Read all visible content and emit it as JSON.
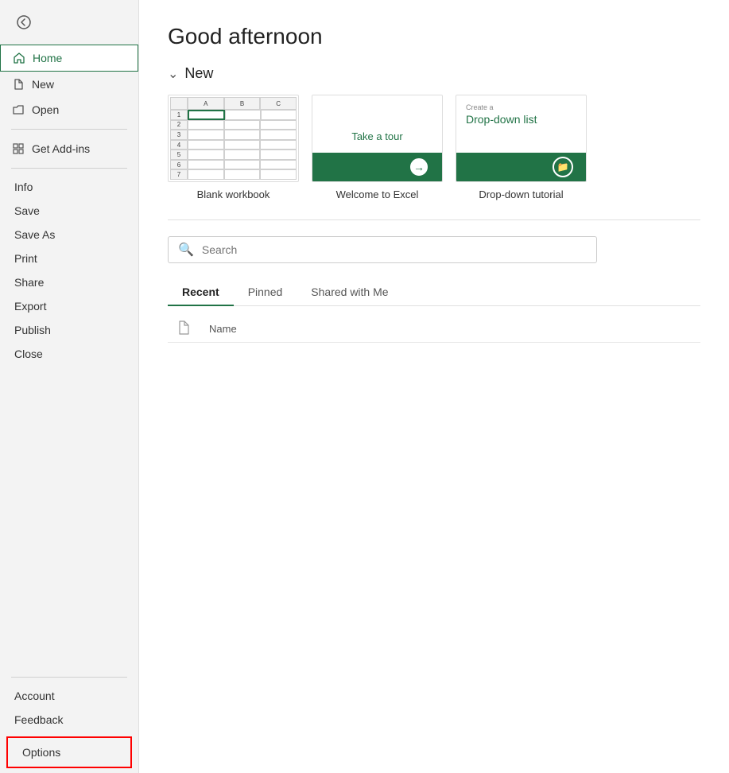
{
  "greeting": "Good afternoon",
  "sidebar": {
    "back_label": "Back",
    "items": [
      {
        "id": "home",
        "label": "Home",
        "icon": "🏠",
        "active": true
      },
      {
        "id": "new",
        "label": "New",
        "icon": "📄"
      },
      {
        "id": "open",
        "label": "Open",
        "icon": "📂"
      }
    ],
    "get_addins": "Get Add-ins",
    "simple_items": [
      "Info",
      "Save",
      "Save As",
      "Print",
      "Share",
      "Export",
      "Publish",
      "Close"
    ],
    "bottom_items": [
      "Account",
      "Feedback"
    ],
    "options_label": "Options"
  },
  "new_section": {
    "label": "New",
    "templates": [
      {
        "id": "blank",
        "label": "Blank workbook"
      },
      {
        "id": "welcome",
        "label": "Welcome to Excel",
        "top_text": "Take a tour"
      },
      {
        "id": "dropdown",
        "label": "Drop-down tutorial",
        "top_text": "Create a",
        "title_text": "Drop-down list"
      }
    ]
  },
  "search": {
    "placeholder": "Search"
  },
  "tabs": [
    {
      "id": "recent",
      "label": "Recent",
      "active": true
    },
    {
      "id": "pinned",
      "label": "Pinned",
      "active": false
    },
    {
      "id": "shared",
      "label": "Shared with Me",
      "active": false
    }
  ],
  "file_list": {
    "name_col": "Name"
  },
  "grid": {
    "cols": [
      "A",
      "B",
      "C"
    ],
    "rows": [
      "1",
      "2",
      "3",
      "4",
      "5",
      "6",
      "7"
    ]
  }
}
